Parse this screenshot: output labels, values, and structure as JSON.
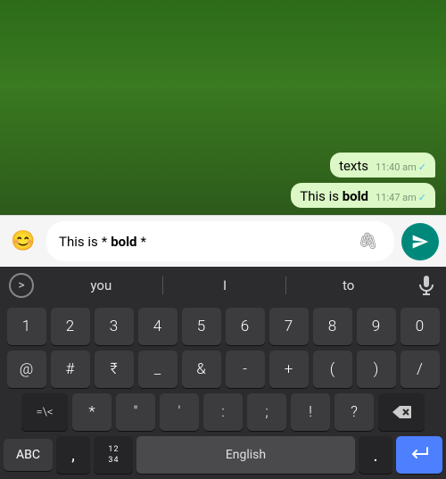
{
  "chat": {
    "bubble1": {
      "text_before": "texts",
      "time": "11:40 am",
      "check": "✓"
    },
    "bubble2": {
      "text_before": "This is ",
      "bold": "bold",
      "time": "11:47 am",
      "check": "✓"
    }
  },
  "input": {
    "text_before": "This is ",
    "text_asterisk1": "*",
    "text_bold": "bold",
    "text_asterisk2": "*",
    "emoji_icon": "😊",
    "attach_icon": "📎"
  },
  "suggestions": {
    "chevron": ">",
    "item1": "you",
    "item2": "I",
    "item3": "to",
    "mic_icon": "🎤"
  },
  "keyboard": {
    "row1": [
      "1",
      "2",
      "3",
      "4",
      "5",
      "6",
      "7",
      "8",
      "9",
      "0"
    ],
    "row2": [
      "@",
      "#",
      "₹",
      "_",
      "&",
      "-",
      "+",
      "(",
      ")",
      "/"
    ],
    "row3_left": "=\\<",
    "row3_mid": [
      "*",
      "\"",
      "'",
      ":",
      ";",
      "!",
      "?"
    ],
    "backspace": "⌫",
    "bottom": {
      "abc": "ABC",
      "comma": ",",
      "num_grid": "12\n34",
      "lang": "English",
      "period": ".",
      "enter": "↵"
    }
  },
  "colors": {
    "send_btn": "#00897b",
    "enter_btn": "#4d7fff",
    "keyboard_bg": "#2c2c2e",
    "key_bg": "#3c3c3e",
    "dark_key_bg": "#252527"
  }
}
